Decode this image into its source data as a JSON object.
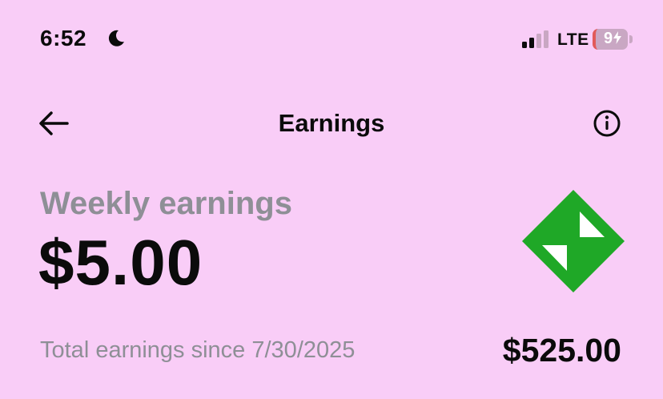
{
  "status_bar": {
    "time": "6:52",
    "network": "LTE",
    "battery": "9"
  },
  "nav": {
    "title": "Earnings"
  },
  "earnings": {
    "weekly_label": "Weekly earnings",
    "weekly_amount": "$5.00",
    "total_label": "Total earnings since 7/30/2025",
    "total_amount": "$525.00"
  },
  "icons": {
    "moon": "moon-icon",
    "signal": "signal-icon",
    "battery": "battery-icon",
    "back": "arrow-left-icon",
    "info": "info-icon",
    "logo": "earnings-logo-icon"
  },
  "colors": {
    "background": "#f9cdf7",
    "logo_green": "#1fa827",
    "muted_text": "#8e8f96"
  }
}
